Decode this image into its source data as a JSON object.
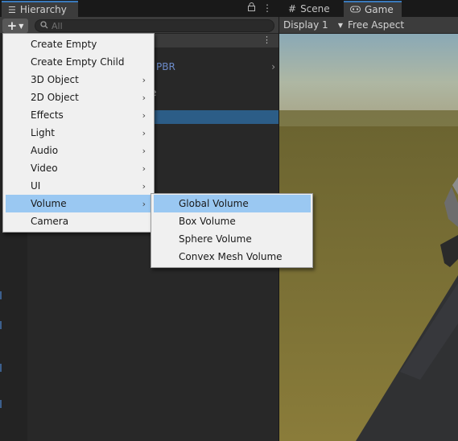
{
  "hierarchy": {
    "tab_label": "Hierarchy",
    "search_placeholder": "All",
    "add_button": "+",
    "row_fragment_1": "PBR",
    "row_fragment_2": "e"
  },
  "game": {
    "scene_tab": "Scene",
    "game_tab": "Game",
    "display": "Display 1",
    "aspect": "Free Aspect"
  },
  "menu": {
    "items": [
      {
        "label": "Create Empty",
        "submenu": false
      },
      {
        "label": "Create Empty Child",
        "submenu": false
      },
      {
        "label": "3D Object",
        "submenu": true
      },
      {
        "label": "2D Object",
        "submenu": true
      },
      {
        "label": "Effects",
        "submenu": true
      },
      {
        "label": "Light",
        "submenu": true
      },
      {
        "label": "Audio",
        "submenu": true
      },
      {
        "label": "Video",
        "submenu": true
      },
      {
        "label": "UI",
        "submenu": true
      },
      {
        "label": "Volume",
        "submenu": true,
        "highlighted": true
      },
      {
        "label": "Camera",
        "submenu": false
      }
    ]
  },
  "volume_submenu": {
    "items": [
      {
        "label": "Global Volume",
        "highlighted": true
      },
      {
        "label": "Box Volume"
      },
      {
        "label": "Sphere Volume"
      },
      {
        "label": "Convex Mesh Volume"
      }
    ]
  },
  "colors": {
    "menu_background": "#f0f0f0",
    "menu_highlight": "#9ac8f2",
    "selection": "#2c5d87",
    "tab_accent": "#3a79bb"
  }
}
